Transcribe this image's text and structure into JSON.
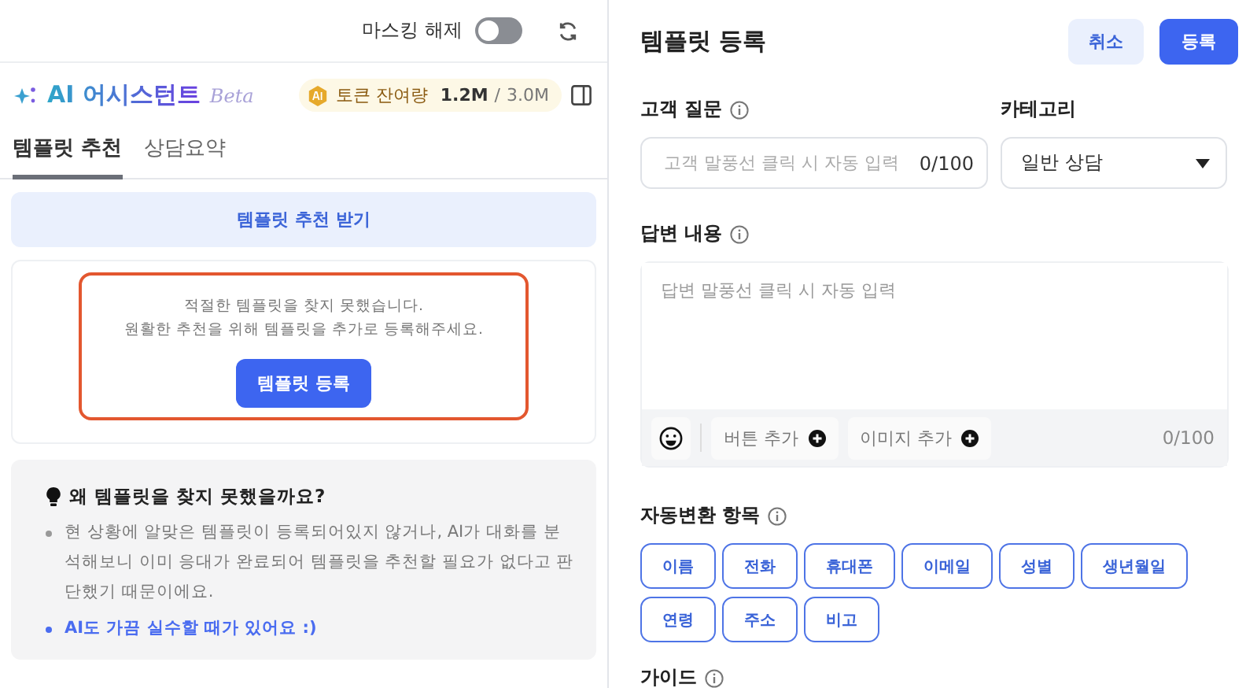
{
  "top_bar": {
    "masking_toggle": {
      "label": "마스킹 해제",
      "on": false
    }
  },
  "assistant": {
    "title": "AI 어시스턴트",
    "badge": "Beta",
    "token": {
      "label": "토큰 잔여량",
      "remaining": "1.2M",
      "separator": "/",
      "total": "3.0M"
    }
  },
  "tabs": [
    {
      "label": "템플릿 추천",
      "selected": true
    },
    {
      "label": "상담요약",
      "selected": false
    }
  ],
  "recommend_button": "템플릿 추천 받기",
  "empty_state": {
    "lines": [
      "적절한 템플릿을 찾지 못했습니다.",
      "원활한 추천을 위해 템플릿을 추가로 등록해주세요."
    ],
    "button": "템플릿 등록"
  },
  "tip": {
    "title": "왜 템플릿을 찾지 못했을까요?",
    "items": [
      {
        "kind": "plain",
        "text": "현 상황에 알맞은 템플릿이 등록되어있지 않거나, AI가 대화를 분석해보니 이미 응대가 완료되어 템플릿을 추천할 필요가 없다고 판단했기 때문이에요."
      },
      {
        "kind": "accent",
        "text": "AI도 가끔 실수할 때가 있어요 :)"
      }
    ]
  },
  "form": {
    "title": "템플릿 등록",
    "cancel": "취소",
    "submit": "등록",
    "question": {
      "label": "고객 질문",
      "placeholder": "고객 말풍선 클릭 시 자동 입력",
      "count": "0/100"
    },
    "category": {
      "label": "카테고리",
      "value": "일반 상담"
    },
    "answer": {
      "label": "답변 내용",
      "placeholder": "답변 말풍선 클릭 시 자동 입력",
      "add_button": "버튼 추가",
      "add_image": "이미지 추가",
      "count": "0/100"
    },
    "auto_fields": {
      "label": "자동변환 항목",
      "chips": [
        "이름",
        "전화",
        "휴대폰",
        "이메일",
        "성별",
        "생년월일",
        "연령",
        "주소",
        "비고"
      ]
    },
    "guide": {
      "label": "가이드"
    }
  }
}
